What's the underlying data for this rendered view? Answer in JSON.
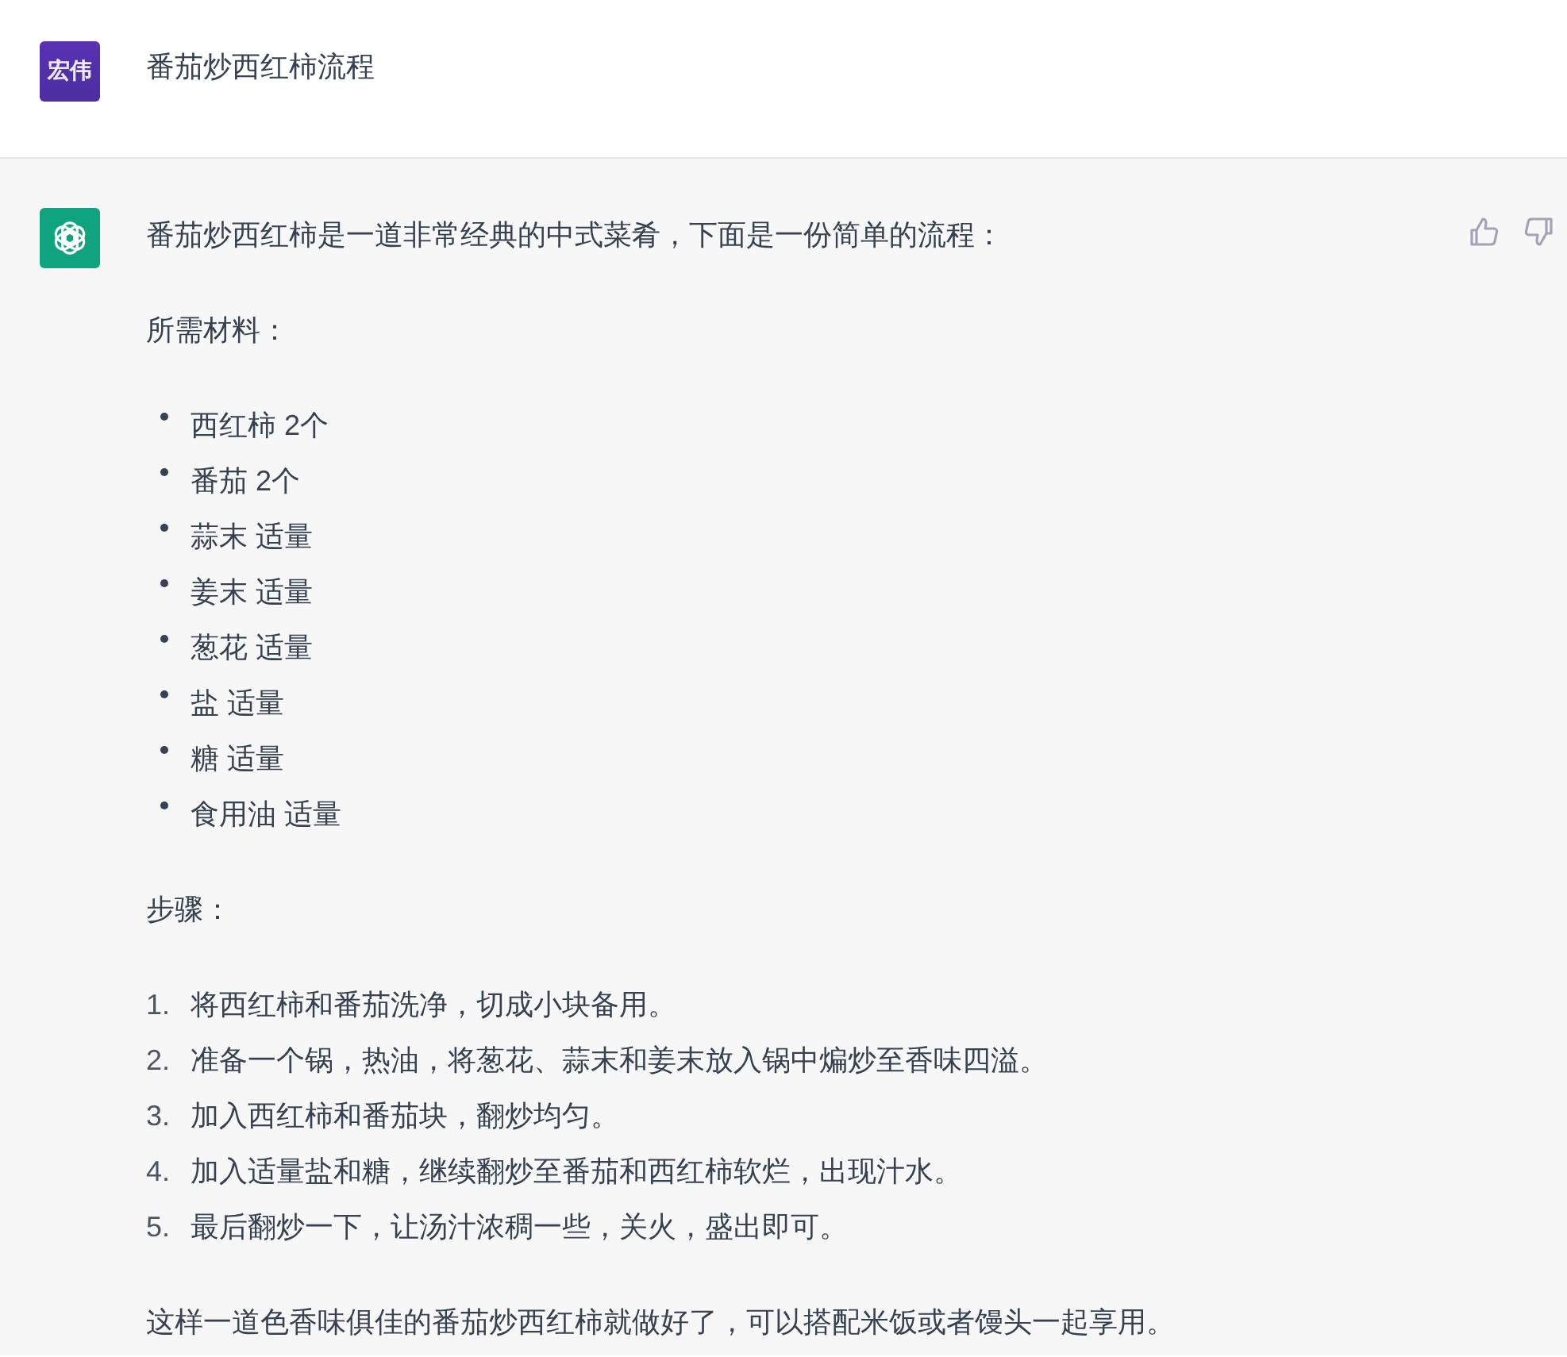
{
  "user_message": {
    "avatar_text": "宏伟",
    "text": "番茄炒西红柿流程"
  },
  "assistant_message": {
    "intro": "番茄炒西红柿是一道非常经典的中式菜肴，下面是一份简单的流程：",
    "ingredients_heading": "所需材料：",
    "ingredients": [
      "西红柿 2个",
      "番茄 2个",
      "蒜末 适量",
      "姜末 适量",
      "葱花 适量",
      "盐 适量",
      "糖 适量",
      "食用油 适量"
    ],
    "steps_heading": "步骤：",
    "steps": [
      {
        "number": "1.",
        "text": "将西红柿和番茄洗净，切成小块备用。"
      },
      {
        "number": "2.",
        "text": "准备一个锅，热油，将葱花、蒜末和姜末放入锅中煸炒至香味四溢。"
      },
      {
        "number": "3.",
        "text": "加入西红柿和番茄块，翻炒均匀。"
      },
      {
        "number": "4.",
        "text": "加入适量盐和糖，继续翻炒至番茄和西红柿软烂，出现汁水。"
      },
      {
        "number": "5.",
        "text": "最后翻炒一下，让汤汁浓稠一些，关火，盛出即可。"
      }
    ],
    "closing": "这样一道色香味俱佳的番茄炒西红柿就做好了，可以搭配米饭或者馒头一起享用。"
  }
}
